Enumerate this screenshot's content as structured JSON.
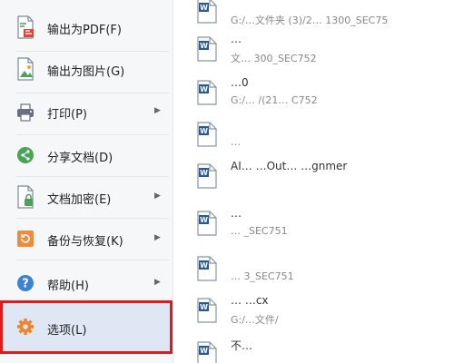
{
  "menu": {
    "items": [
      {
        "label": "输出为PDF(F)",
        "icon": "export-pdf-icon",
        "has_submenu": false
      },
      {
        "label": "输出为图片(G)",
        "icon": "export-image-icon",
        "has_submenu": false
      },
      {
        "label": "打印(P)",
        "icon": "printer-icon",
        "has_submenu": true
      },
      {
        "label": "分享文档(D)",
        "icon": "share-icon",
        "has_submenu": false
      },
      {
        "label": "文档加密(E)",
        "icon": "document-lock-icon",
        "has_submenu": true
      },
      {
        "label": "备份与恢复(K)",
        "icon": "backup-restore-icon",
        "has_submenu": true
      },
      {
        "label": "帮助(H)",
        "icon": "help-icon",
        "has_submenu": true
      },
      {
        "label": "选项(L)",
        "icon": "gear-icon",
        "has_submenu": false,
        "highlighted": true
      }
    ],
    "submenu_arrow": "▶"
  },
  "recent_files": {
    "rows": [
      {
        "name": "",
        "path": "G:/…文件夹 (3)/2… 1300_SEC75"
      },
      {
        "name": "…",
        "path": "文…  300_SEC752"
      },
      {
        "name": "…0",
        "path": "G:/… /(21… C752"
      },
      {
        "name": "",
        "path": "…"
      },
      {
        "name": "AI…  …Out…  …gnmer",
        "path": ""
      },
      {
        "name": "…",
        "path": "… _SEC751"
      },
      {
        "name": "",
        "path": "… 3_SEC751"
      },
      {
        "name": "…  …cx",
        "path": "G:/…文件/"
      },
      {
        "name": "不…",
        "path": ""
      }
    ]
  },
  "colors": {
    "highlight_border": "#e01b1b",
    "highlight_bg": "#dfe7f5",
    "word_icon_blue": "#2b5797"
  }
}
